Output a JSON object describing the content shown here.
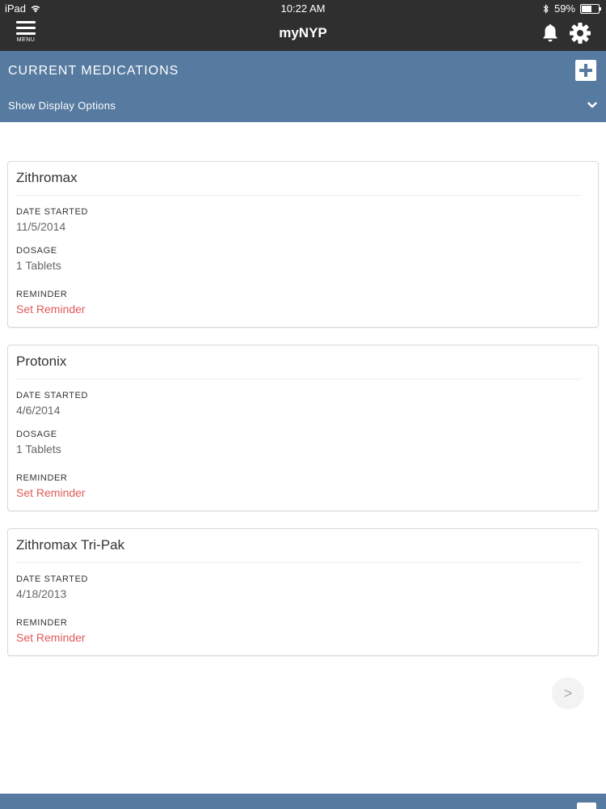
{
  "status_bar": {
    "carrier": "iPad",
    "time": "10:22 AM",
    "battery": "59%"
  },
  "nav": {
    "menu_label": "MENU",
    "title": "myNYP"
  },
  "section": {
    "title": "CURRENT MEDICATIONS",
    "display_options": "Show Display Options"
  },
  "medications": [
    {
      "name": "Zithromax",
      "date_label": "DATE STARTED",
      "date": "11/5/2014",
      "dosage_label": "DOSAGE",
      "dosage": "1 Tablets",
      "reminder_label": "REMINDER",
      "reminder": "Set Reminder"
    },
    {
      "name": "Protonix",
      "date_label": "DATE STARTED",
      "date": "4/6/2014",
      "dosage_label": "DOSAGE",
      "dosage": "1 Tablets",
      "reminder_label": "REMINDER",
      "reminder": "Set Reminder"
    },
    {
      "name": "Zithromax Tri-Pak",
      "date_label": "DATE STARTED",
      "date": "4/18/2013",
      "reminder_label": "REMINDER",
      "reminder": "Set Reminder"
    }
  ],
  "pagination": {
    "next": ">"
  },
  "colors": {
    "header": "#567aa0",
    "navbar": "#2f2f2f",
    "link": "#e05a5a"
  },
  "icons": {
    "menu": "hamburger-icon",
    "notifications": "bell-icon",
    "settings": "gear-icon",
    "add": "plus-icon",
    "expand": "chevron-down-icon"
  }
}
